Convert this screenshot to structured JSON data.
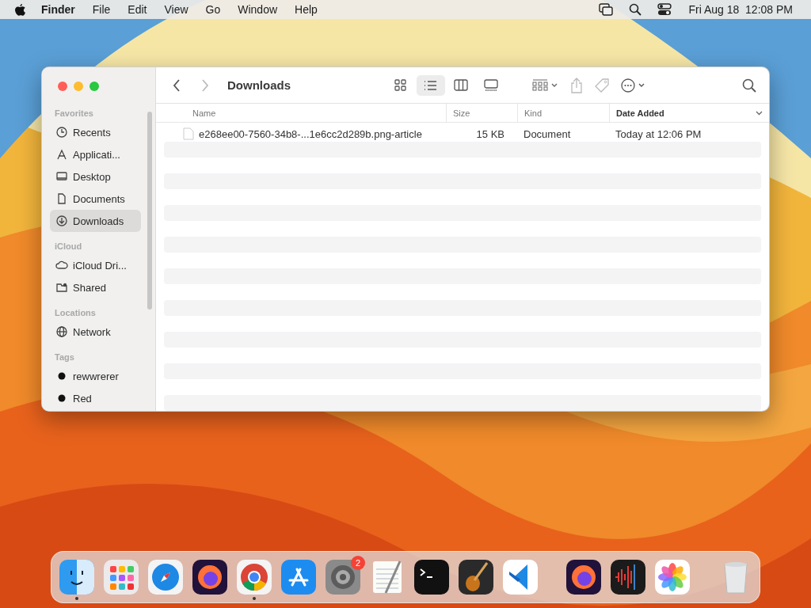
{
  "menubar": {
    "app": "Finder",
    "menus": [
      "File",
      "Edit",
      "View",
      "Go",
      "Window",
      "Help"
    ],
    "clock": "Fri Aug 18  12:08 PM"
  },
  "window": {
    "title": "Downloads",
    "sidebar": [
      {
        "heading": "Favorites",
        "items": [
          {
            "label": "Recents",
            "kind": "clock",
            "selected": false
          },
          {
            "label": "Applicati...",
            "kind": "apps",
            "selected": false
          },
          {
            "label": "Desktop",
            "kind": "desktop",
            "selected": false
          },
          {
            "label": "Documents",
            "kind": "doc",
            "selected": false
          },
          {
            "label": "Downloads",
            "kind": "download",
            "selected": true
          }
        ]
      },
      {
        "heading": "iCloud",
        "items": [
          {
            "label": "iCloud Dri...",
            "kind": "cloud",
            "selected": false
          },
          {
            "label": "Shared",
            "kind": "shared",
            "selected": false
          }
        ]
      },
      {
        "heading": "Locations",
        "items": [
          {
            "label": "Network",
            "kind": "globe",
            "selected": false
          }
        ]
      },
      {
        "heading": "Tags",
        "items": [
          {
            "label": "rewwrerer",
            "kind": "tag",
            "selected": false
          },
          {
            "label": "Red",
            "kind": "tag",
            "selected": false
          }
        ]
      }
    ],
    "views": [
      {
        "kind": "icons",
        "selected": false
      },
      {
        "kind": "list",
        "selected": true
      },
      {
        "kind": "columns",
        "selected": false
      },
      {
        "kind": "gallery",
        "selected": false
      }
    ],
    "columns": [
      {
        "label": "Name",
        "sorted": false
      },
      {
        "label": "Size",
        "sorted": false
      },
      {
        "label": "Kind",
        "sorted": false
      },
      {
        "label": "Date Added",
        "sorted": true
      }
    ],
    "rows": [
      {
        "name": "e268ee00-7560-34b8-...1e6cc2d289b.png-article",
        "size": "15 KB",
        "kind": "Document",
        "date": "Today at 12:06 PM"
      }
    ]
  },
  "dock": {
    "apps": [
      {
        "kind": "finder",
        "running": true
      },
      {
        "kind": "launchpad",
        "running": false
      },
      {
        "kind": "safari",
        "running": false
      },
      {
        "kind": "firefox",
        "running": false
      },
      {
        "kind": "chrome",
        "running": true
      },
      {
        "kind": "appstore",
        "running": false
      },
      {
        "kind": "settings",
        "running": false,
        "badge": "2"
      },
      {
        "kind": "textedit",
        "running": false
      },
      {
        "kind": "terminal",
        "running": false
      },
      {
        "kind": "garageband",
        "running": false
      },
      {
        "kind": "vscode",
        "running": false
      }
    ],
    "recent": [
      {
        "kind": "firefox",
        "running": false
      },
      {
        "kind": "memos",
        "running": false
      },
      {
        "kind": "photos",
        "running": false
      }
    ],
    "trash": {
      "kind": "trash",
      "running": false
    }
  }
}
